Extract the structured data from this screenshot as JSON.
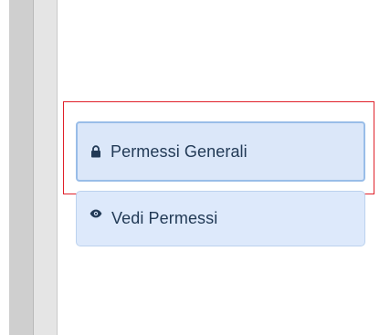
{
  "colors": {
    "highlight_border": "#e0202a",
    "button_bg": "#dbe7f9",
    "button_border": "#99bde8",
    "button_text": "#223a56"
  },
  "actions": {
    "general_permissions": {
      "label": "Permessi Generali",
      "icon": "lock-icon"
    },
    "view_permissions": {
      "label": "Vedi Permessi",
      "icon": "eye-icon"
    }
  }
}
